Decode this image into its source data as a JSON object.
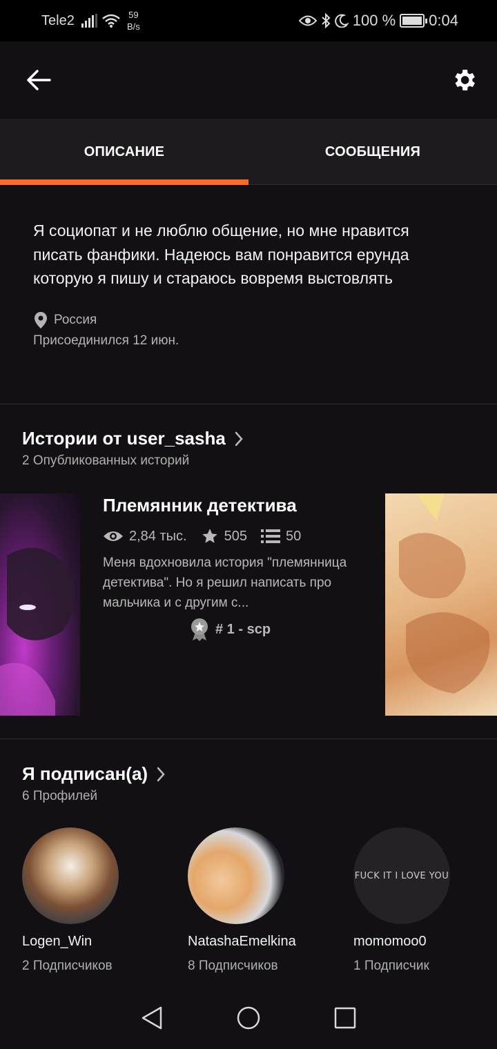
{
  "status_bar": {
    "carrier": "Tele2",
    "speed_value": "59",
    "speed_unit": "B/s",
    "battery": "100 %",
    "time": "0:04"
  },
  "header": {
    "back_icon": "arrow-left-icon",
    "settings_icon": "gear-icon"
  },
  "tabs": [
    {
      "label": "ОПИСАНИЕ",
      "active": true
    },
    {
      "label": "СООБЩЕНИЯ",
      "active": false
    }
  ],
  "accent_color": "#ff6a2b",
  "profile": {
    "description": "Я социопат и не люблю общение, но мне нравится писать фанфики. Надеюсь вам понравится ерунда которую я пишу и стараюсь вовремя выстовлять",
    "location": "Россия",
    "joined": "Присоединился 12 июн."
  },
  "stories": {
    "title": "Истории от user_sasha",
    "subtitle": "2 Опубликованных историй",
    "featured": {
      "title": "Племянник детектива",
      "views": "2,84 тыс.",
      "votes": "505",
      "parts": "50",
      "description": "Меня вдохновила история \"племянница детектива\". Но я решил написать про мальчика и с другим с...",
      "rank": "# 1 - scp"
    }
  },
  "following": {
    "title": "Я подписан(а)",
    "subtitle": "6 Профилей",
    "profiles": [
      {
        "name": "Logen_Win",
        "followers": "2 Подписчиков"
      },
      {
        "name": "NatashaEmelkina",
        "followers": "8 Подписчиков"
      },
      {
        "name": "momomoo0",
        "followers": "1 Подписчик",
        "avatar_text": "FUCK IT I LOVE YOU"
      }
    ]
  }
}
